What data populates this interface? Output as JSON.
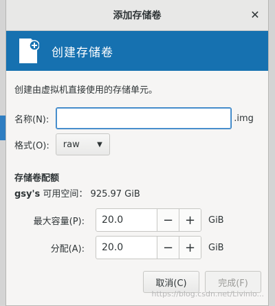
{
  "window": {
    "title": "添加存储卷"
  },
  "banner": {
    "text": "创建存储卷"
  },
  "description": "创建由虚拟机直接使用的存储单元。",
  "name": {
    "label": "名称(N):",
    "value": "",
    "suffix": ".img"
  },
  "format": {
    "label": "格式(O):",
    "value": "raw"
  },
  "storage": {
    "title": "存储卷配额",
    "user": "gsy's",
    "available_label": "可用空间：",
    "available_value": "925.97 GiB"
  },
  "max_capacity": {
    "label": "最大容量(P):",
    "value": "20.0",
    "unit": "GiB"
  },
  "allocation": {
    "label": "分配(A):",
    "value": "20.0",
    "unit": "GiB"
  },
  "buttons": {
    "cancel": "取消(C)",
    "finish": "完成(F)"
  },
  "watermark": "https://blog.csdn.net/Livinio..."
}
